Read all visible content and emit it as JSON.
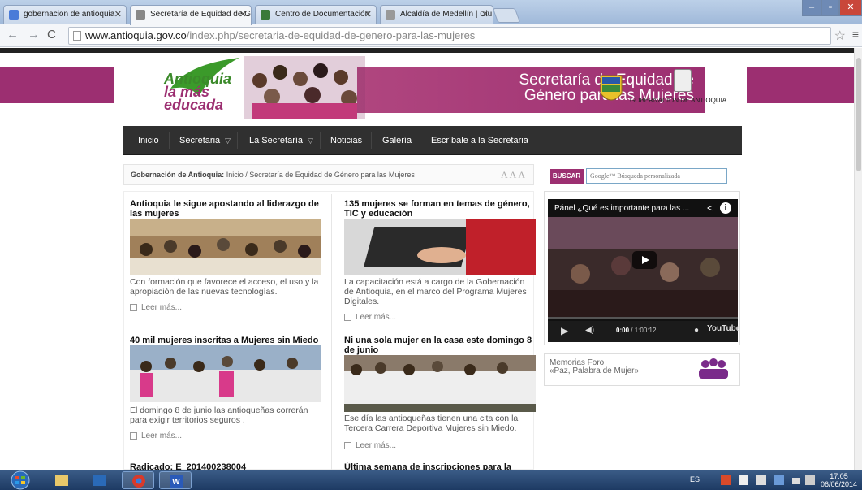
{
  "browser": {
    "tabs": [
      {
        "title": "gobernacion de antioquia",
        "favicon_color": "#4a7bd8"
      },
      {
        "title": "Secretaría de Equidad de G",
        "favicon_color": "#888888"
      },
      {
        "title": "Centro de Documentación",
        "favicon_color": "#3a7a3a"
      },
      {
        "title": "Alcaldía de Medellín | Ciu",
        "favicon_color": "#999999"
      }
    ],
    "url_host": "www.antioquia.gov.co",
    "url_path": "/index.php/secretaria-de-equidad-de-genero-para-las-mujeres"
  },
  "banner": {
    "logo_line1": "Antioquia",
    "logo_line2": "la más",
    "logo_line3": "educada",
    "title_line1": "Secretaría de Equidad de",
    "title_line2": "Género para las Mujeres",
    "gob": "GOBERNACIÓN DE ANTIOQUIA"
  },
  "nav": [
    {
      "label": "Inicio",
      "dropdown": false
    },
    {
      "label": "Secretaria",
      "dropdown": true
    },
    {
      "label": "La Secretaría",
      "dropdown": true
    },
    {
      "label": "Noticias",
      "dropdown": false
    },
    {
      "label": "Galería",
      "dropdown": false
    },
    {
      "label": "Escríbale a la Secretaria",
      "dropdown": false
    }
  ],
  "breadcrumb": {
    "prefix": "Gobernación de Antioquia:",
    "home": "Inicio",
    "sep": "/",
    "current": "Secretaría de Equidad de Género para las Mujeres",
    "font_size_tool": "AAA"
  },
  "search": {
    "button": "BUSCAR",
    "placeholder": "Google™ Búsqueda personalizada"
  },
  "articles": [
    {
      "title": "Antioquia le sigue apostando al liderazgo de las mujeres",
      "text": "Con formación que favorece el acceso, el uso y la apropiación de las nuevas tecnologías.",
      "more": "Leer más..."
    },
    {
      "title": "135 mujeres se forman en temas de género, TIC y educación",
      "text": "La capacitación está a cargo de la Gobernación de Antioquia, en el marco del Programa Mujeres Digitales.",
      "more": "Leer más..."
    },
    {
      "title": "40 mil mujeres inscritas a Mujeres sin Miedo",
      "text": "El domingo 8 de junio las antioqueñas correrán para exigir territorios seguros .",
      "more": "Leer más..."
    },
    {
      "title": "Ni una sola mujer en la casa este domingo 8 de junio",
      "text": "Ese día las antioqueñas tienen una cita con la Tercera Carrera Deportiva Mujeres sin Miedo.",
      "more": "Leer más..."
    },
    {
      "title": "Radicado: E_201400238004",
      "text": "",
      "more": ""
    },
    {
      "title": "Última semana de inscripciones para la",
      "text": "",
      "more": ""
    }
  ],
  "video": {
    "title": "Pánel ¿Qué es importante para las ...",
    "time_current": "0:00",
    "time_total": "/ 1:00:12",
    "brand": "YouTube"
  },
  "foro": {
    "line1": "Memorias Foro",
    "line2": "«Paz, Palabra de Mujer»"
  },
  "taskbar": {
    "lang": "ES",
    "time": "17:05",
    "date": "06/06/2014"
  },
  "colors": {
    "brand_magenta": "#9c2f71",
    "nav_bg": "#303030",
    "logo_green": "#3b8a2a"
  }
}
